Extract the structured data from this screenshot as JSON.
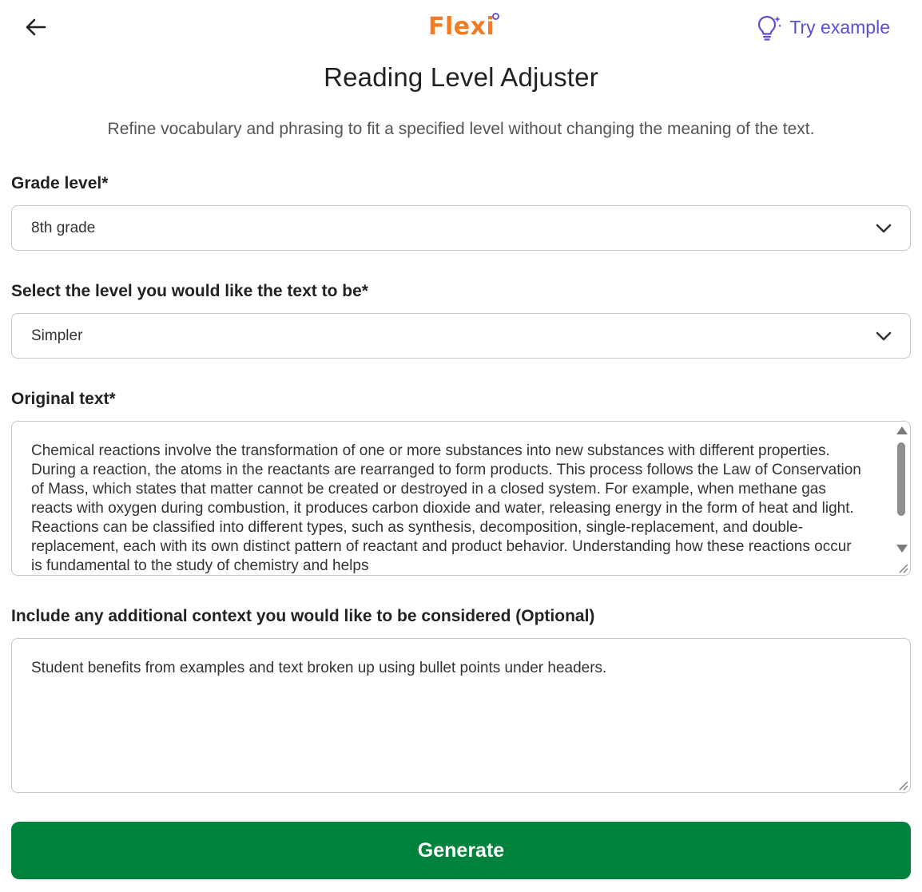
{
  "header": {
    "back_icon": "arrow-left-icon",
    "logo_text": "Flexi",
    "try_example_label": "Try example",
    "try_example_icon": "lightbulb-sparkle-icon"
  },
  "page": {
    "title": "Reading Level Adjuster",
    "subtitle": "Refine vocabulary and phrasing to fit a specified level without changing the meaning of the text."
  },
  "form": {
    "grade_level": {
      "label": "Grade level*",
      "value": "8th grade"
    },
    "target_level": {
      "label": "Select the level you would like the text to be*",
      "value": "Simpler"
    },
    "original_text": {
      "label": "Original text*",
      "value": "Chemical reactions involve the transformation of one or more substances into new substances with different properties. During a reaction, the atoms in the reactants are rearranged to form products. This process follows the Law of Conservation of Mass, which states that matter cannot be created or destroyed in a closed system. For example, when methane gas reacts with oxygen during combustion, it produces carbon dioxide and water, releasing energy in the form of heat and light. Reactions can be classified into different types, such as synthesis, decomposition, single-replacement, and double-replacement, each with its own distinct pattern of reactant and product behavior. Understanding how these reactions occur is fundamental to the study of chemistry and helps"
    },
    "additional_context": {
      "label": "Include any additional context you would like to be considered (Optional)",
      "value": "Student benefits from examples and text broken up using bullet points under headers."
    },
    "generate_label": "Generate"
  },
  "colors": {
    "brand_orange": "#f47b20",
    "accent_purple": "#5b4fcf",
    "generate_green": "#00843d"
  }
}
